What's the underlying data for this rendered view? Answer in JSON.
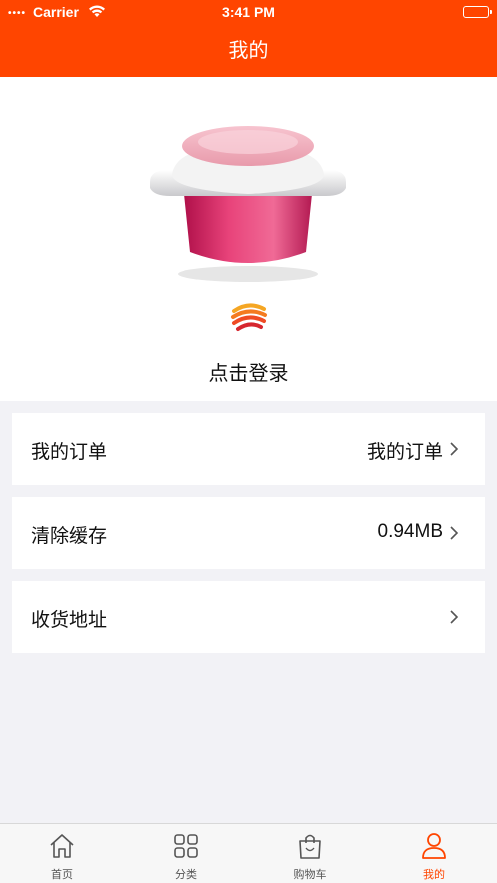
{
  "status": {
    "signal_dots": "••••",
    "carrier": "Carrier",
    "time": "3:41 PM"
  },
  "nav": {
    "title": "我的"
  },
  "profile": {
    "login_label": "点击登录"
  },
  "menu": [
    {
      "label": "我的订单",
      "value": "我的订单"
    },
    {
      "label": "清除缓存",
      "value": "0.94MB"
    },
    {
      "label": "收货地址",
      "value": ""
    }
  ],
  "tabs": [
    {
      "label": "首页",
      "icon": "home-icon"
    },
    {
      "label": "分类",
      "icon": "grid-icon"
    },
    {
      "label": "购物车",
      "icon": "shopping-bag-icon"
    },
    {
      "label": "我的",
      "icon": "user-icon"
    }
  ],
  "colors": {
    "accent": "#ff4500",
    "background": "#f2f2f6"
  }
}
